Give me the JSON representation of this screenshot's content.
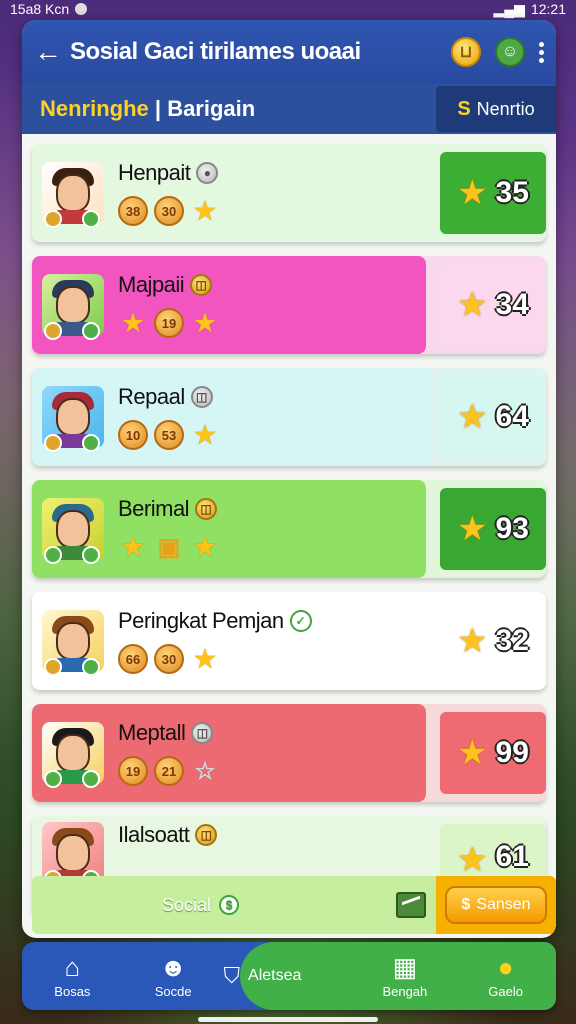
{
  "status_bar": {
    "left": "15a8 Kcn",
    "right": "12:21"
  },
  "header": {
    "title": "Sosial Gaci tirilames uoaai",
    "coin_icon": "coin-icon",
    "profile_icon": "profile-icon"
  },
  "subheader": {
    "title_highlight": "Nenringhe",
    "title_separator": " | ",
    "title_rest": "Barigain",
    "filter_symbol": "S",
    "filter_label": "Nenrtio"
  },
  "players": [
    {
      "name": "Henpait",
      "tokens": [
        "38",
        "30",
        "★"
      ],
      "score": "35"
    },
    {
      "name": "Majpaii",
      "tokens": [
        "★",
        "19",
        "★"
      ],
      "score": "34"
    },
    {
      "name": "Repaal",
      "tokens": [
        "10",
        "53",
        "★"
      ],
      "score": "64"
    },
    {
      "name": "Berimal",
      "tokens": [
        "★",
        "chest",
        "★"
      ],
      "score": "93"
    },
    {
      "name": "Peringkat Pemjan",
      "tokens": [
        "66",
        "30",
        "★"
      ],
      "score": "32"
    },
    {
      "name": "Meptall",
      "tokens": [
        "19",
        "21",
        "☆"
      ],
      "score": "99"
    },
    {
      "name": "Ilalsoatt",
      "tokens": [],
      "score": "61"
    }
  ],
  "social_bar": {
    "label": "Social",
    "action_label": "Sansen"
  },
  "bottom_nav": [
    {
      "label": "Bosas",
      "icon": "house-icon"
    },
    {
      "label": "Socde",
      "icon": "users-icon"
    },
    {
      "label": "Aletsea",
      "icon": "shield-icon"
    },
    {
      "label": "Bengah",
      "icon": "store-icon"
    },
    {
      "label": "Gaelo",
      "icon": "trophy-icon"
    }
  ],
  "colors": {
    "header_blue": "#2f56b0",
    "highlight_yellow": "#ffd21e",
    "active_green": "#42b048"
  }
}
